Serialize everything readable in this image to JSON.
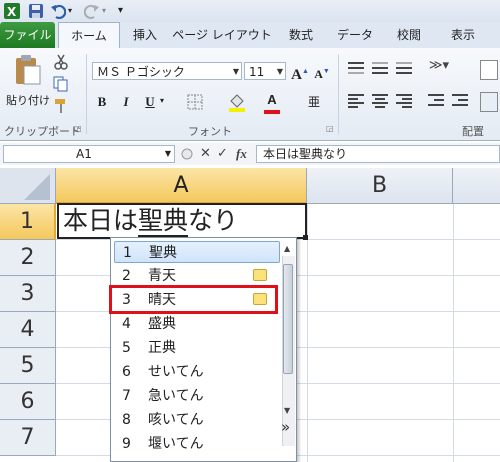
{
  "quick_access": {
    "customize_label": "▾"
  },
  "tabs": [
    "ファイル",
    "ホーム",
    "挿入",
    "ページ レイアウト",
    "数式",
    "データ",
    "校閲",
    "表示"
  ],
  "ribbon": {
    "clipboard": {
      "paste_label": "貼り付け",
      "group_label": "クリップボード"
    },
    "font": {
      "name": "ＭＳ Ｐゴシック",
      "size": "11",
      "group_label": "フォント",
      "bold": "B",
      "italic": "I",
      "underline": "U",
      "grow": "A",
      "shrink": "A",
      "font_color": "A",
      "furigana": "亜"
    },
    "alignment": {
      "group_label": "配置"
    }
  },
  "formula_bar": {
    "name_box": "A1",
    "fx": "fx",
    "content": "本日は聖典なり"
  },
  "grid": {
    "columns": [
      "A",
      "B"
    ],
    "rows": [
      "1",
      "2",
      "3",
      "4",
      "5",
      "6",
      "7"
    ],
    "cell_a1": {
      "prefix": "本日は",
      "underlined": "聖典",
      "suffix": "なり"
    }
  },
  "ime": {
    "candidates": [
      {
        "num": "1",
        "text": "聖典"
      },
      {
        "num": "2",
        "text": "青天"
      },
      {
        "num": "3",
        "text": "晴天"
      },
      {
        "num": "4",
        "text": "盛典"
      },
      {
        "num": "5",
        "text": "正典"
      },
      {
        "num": "6",
        "text": "せいてん"
      },
      {
        "num": "7",
        "text": "急いてん"
      },
      {
        "num": "8",
        "text": "咳いてん"
      },
      {
        "num": "9",
        "text": "堰いてん"
      }
    ],
    "expand_label": "»"
  },
  "colors": {
    "accent_red": "#e0101a",
    "selection": "#f5c85c",
    "file_tab": "#1e7a22"
  }
}
